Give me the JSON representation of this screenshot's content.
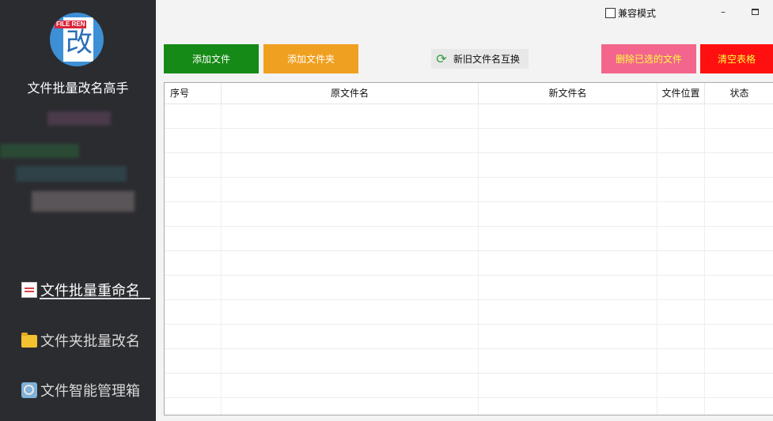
{
  "sidebar": {
    "logo": {
      "tag": "FILE REN",
      "glyph": "改"
    },
    "app_title": "文件批量改名高手",
    "nav": [
      {
        "label": "文件批量重命名",
        "icon": "document-list-icon",
        "active": true
      },
      {
        "label": "文件夹批量改名",
        "icon": "folder-icon",
        "active": false
      },
      {
        "label": "文件智能管理箱",
        "icon": "image-search-icon",
        "active": false
      }
    ]
  },
  "topbar": {
    "compat_label": "兼容模式",
    "compat_checked": false,
    "minimize": "–"
  },
  "toolbar": {
    "add_file": "添加文件",
    "add_folder": "添加文件夹",
    "swap_names": "新旧文件名互换",
    "delete_selected": "删除已选的文件",
    "clear_table": "清空表格"
  },
  "colors": {
    "sidebar_bg": "#2b2c30",
    "add_file": "#168a16",
    "add_folder": "#f0a020",
    "delete_selected": "#f3658c",
    "clear_table": "#ff1010",
    "warning_text": "#ffff40"
  },
  "table": {
    "columns": [
      "序号",
      "原文件名",
      "新文件名",
      "文件位置",
      "状态"
    ],
    "rows": []
  }
}
